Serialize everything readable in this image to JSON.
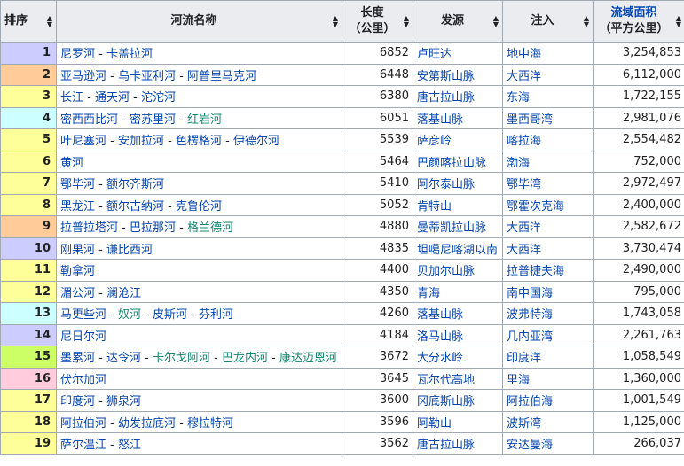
{
  "colors": {
    "header_bg": "#eaecf0",
    "border": "#a2a9b1",
    "link": "#0645ad",
    "green_link": "#14866d",
    "rank_lavender": "#ccccff",
    "rank_orange": "#ffcc99",
    "rank_yellow": "#ffff99",
    "rank_cyan": "#ccffff",
    "rank_lime": "#ccff66",
    "rank_pink": "#ffccdd"
  },
  "headers": {
    "rank": "排序",
    "name": "河流名称",
    "length_line1": "长度",
    "length_line2": "（公里）",
    "source": "发源",
    "outflow": "注入",
    "area_line1": "流域面积",
    "area_line2": "（平方公里）"
  },
  "rows": [
    {
      "rank": "1",
      "rank_color": "lavender",
      "name_parts": [
        {
          "text": "尼罗河",
          "color": "link"
        },
        {
          "text": "卡盖拉河",
          "color": "link"
        }
      ],
      "length": "6852",
      "source": "卢旺达",
      "outflow": "地中海",
      "area": "3,254,853"
    },
    {
      "rank": "2",
      "rank_color": "orange",
      "name_parts": [
        {
          "text": "亚马逊河",
          "color": "link"
        },
        {
          "text": "乌卡亚利河",
          "color": "link"
        },
        {
          "text": "阿普里马克河",
          "color": "link"
        }
      ],
      "length": "6448",
      "source": "安第斯山脉",
      "outflow": "大西洋",
      "area": "6,112,000"
    },
    {
      "rank": "3",
      "rank_color": "yellow",
      "name_parts": [
        {
          "text": "长江",
          "color": "link"
        },
        {
          "text": "通天河",
          "color": "link"
        },
        {
          "text": "沱沱河",
          "color": "link"
        }
      ],
      "length": "6380",
      "source": "唐古拉山脉",
      "outflow": "东海",
      "area": "1,722,155"
    },
    {
      "rank": "4",
      "rank_color": "cyan",
      "name_parts": [
        {
          "text": "密西西比河",
          "color": "link"
        },
        {
          "text": "密苏里河",
          "color": "link"
        },
        {
          "text": "红岩河",
          "color": "green"
        }
      ],
      "length": "6051",
      "source": "落基山脉",
      "outflow": "墨西哥湾",
      "area": "2,981,076"
    },
    {
      "rank": "5",
      "rank_color": "yellow",
      "name_parts": [
        {
          "text": "叶尼塞河",
          "color": "link"
        },
        {
          "text": "安加拉河",
          "color": "link"
        },
        {
          "text": "色楞格河",
          "color": "link"
        },
        {
          "text": "伊德尔河",
          "color": "link"
        }
      ],
      "length": "5539",
      "source": "萨彦岭",
      "outflow": "喀拉海",
      "area": "2,554,482"
    },
    {
      "rank": "6",
      "rank_color": "yellow",
      "name_parts": [
        {
          "text": "黄河",
          "color": "link"
        }
      ],
      "length": "5464",
      "source": "巴颜喀拉山脉",
      "outflow": "渤海",
      "area": "752,000"
    },
    {
      "rank": "7",
      "rank_color": "yellow",
      "name_parts": [
        {
          "text": "鄂毕河",
          "color": "link"
        },
        {
          "text": "额尔齐斯河",
          "color": "link"
        }
      ],
      "length": "5410",
      "source": "阿尔泰山脉",
      "outflow": "鄂毕湾",
      "area": "2,972,497"
    },
    {
      "rank": "8",
      "rank_color": "yellow",
      "name_parts": [
        {
          "text": "黑龙江",
          "color": "link"
        },
        {
          "text": "额尔古纳河",
          "color": "link"
        },
        {
          "text": "克鲁伦河",
          "color": "link"
        }
      ],
      "length": "5052",
      "source": "肯特山",
      "outflow": "鄂霍次克海",
      "area": "2,400,000"
    },
    {
      "rank": "9",
      "rank_color": "orange",
      "name_parts": [
        {
          "text": "拉普拉塔河",
          "color": "link"
        },
        {
          "text": "巴拉那河",
          "color": "link"
        },
        {
          "text": "格兰德河",
          "color": "green"
        }
      ],
      "length": "4880",
      "source": "曼蒂凯拉山脉",
      "outflow": "大西洋",
      "area": "2,582,672"
    },
    {
      "rank": "10",
      "rank_color": "lavender",
      "name_parts": [
        {
          "text": "刚果河",
          "color": "link"
        },
        {
          "text": "谦比西河",
          "color": "link"
        }
      ],
      "length": "4835",
      "source": "坦噶尼喀湖以南",
      "outflow": "大西洋",
      "area": "3,730,474"
    },
    {
      "rank": "11",
      "rank_color": "yellow",
      "name_parts": [
        {
          "text": "勒拿河",
          "color": "link"
        }
      ],
      "length": "4400",
      "source": "贝加尔山脉",
      "outflow": "拉普捷夫海",
      "area": "2,490,000"
    },
    {
      "rank": "12",
      "rank_color": "yellow",
      "name_parts": [
        {
          "text": "湄公河",
          "color": "link"
        },
        {
          "text": "澜沧江",
          "color": "link"
        }
      ],
      "length": "4350",
      "source": "青海",
      "outflow": "南中国海",
      "area": "795,000"
    },
    {
      "rank": "13",
      "rank_color": "cyan",
      "name_parts": [
        {
          "text": "马更些河",
          "color": "link"
        },
        {
          "text": "奴河",
          "color": "green"
        },
        {
          "text": "皮斯河",
          "color": "link"
        },
        {
          "text": "芬利河",
          "color": "link"
        }
      ],
      "length": "4260",
      "source": "落基山脉",
      "outflow": "波弗特海",
      "area": "1,743,058"
    },
    {
      "rank": "14",
      "rank_color": "lavender",
      "name_parts": [
        {
          "text": "尼日尔河",
          "color": "link"
        }
      ],
      "length": "4184",
      "source": "洛马山脉",
      "outflow": "几内亚湾",
      "area": "2,261,763"
    },
    {
      "rank": "15",
      "rank_color": "lime",
      "name_parts": [
        {
          "text": "墨累河",
          "color": "link"
        },
        {
          "text": "达令河",
          "color": "link"
        },
        {
          "text": "卡尔戈阿河",
          "color": "green"
        },
        {
          "text": "巴龙内河",
          "color": "green"
        },
        {
          "text": "康达迈恩河",
          "color": "green"
        }
      ],
      "length": "3672",
      "source": "大分水岭",
      "outflow": "印度洋",
      "area": "1,058,549"
    },
    {
      "rank": "16",
      "rank_color": "pink",
      "name_parts": [
        {
          "text": "伏尔加河",
          "color": "link"
        }
      ],
      "length": "3645",
      "source": "瓦尔代高地",
      "outflow": "里海",
      "area": "1,360,000"
    },
    {
      "rank": "17",
      "rank_color": "yellow",
      "name_parts": [
        {
          "text": "印度河",
          "color": "link"
        },
        {
          "text": "狮泉河",
          "color": "link"
        }
      ],
      "length": "3600",
      "source": "冈底斯山脉",
      "outflow": "阿拉伯海",
      "area": "1,001,549"
    },
    {
      "rank": "18",
      "rank_color": "yellow",
      "name_parts": [
        {
          "text": "阿拉伯河",
          "color": "link"
        },
        {
          "text": "幼发拉底河",
          "color": "link"
        },
        {
          "text": "穆拉特河",
          "color": "link"
        }
      ],
      "length": "3596",
      "source": "阿勒山",
      "outflow": "波斯湾",
      "area": "1,125,000"
    },
    {
      "rank": "19",
      "rank_color": "yellow",
      "name_parts": [
        {
          "text": "萨尔温江",
          "color": "link"
        },
        {
          "text": "怒江",
          "color": "link"
        }
      ],
      "length": "3562",
      "source": "唐古拉山脉",
      "outflow": "安达曼海",
      "area": "266,037"
    }
  ]
}
